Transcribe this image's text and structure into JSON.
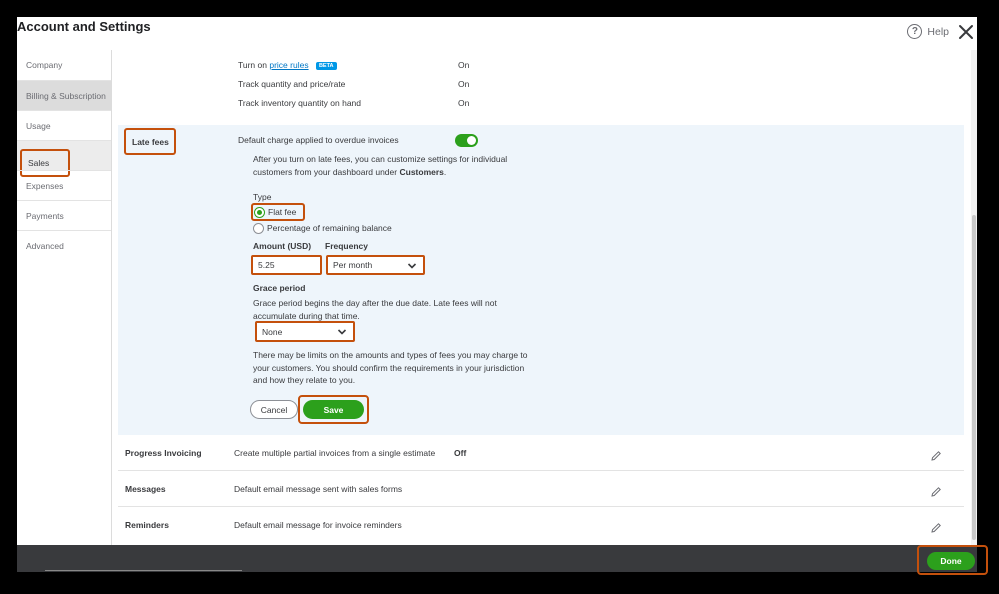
{
  "window": {
    "title": "Account and Settings",
    "help_label": "Help"
  },
  "sidebar": {
    "items": [
      {
        "label": "Company"
      },
      {
        "label": "Billing & Subscription"
      },
      {
        "label": "Usage"
      },
      {
        "label": "Sales"
      },
      {
        "label": "Expenses"
      },
      {
        "label": "Payments"
      },
      {
        "label": "Advanced"
      }
    ]
  },
  "products": {
    "price_rules_prefix": "Turn on",
    "price_rules_link": "price rules",
    "beta_badge": "BETA",
    "price_rules_value": "On",
    "track_qty_label": "Track quantity and price/rate",
    "track_qty_value": "On",
    "track_inventory_label": "Track inventory quantity on hand",
    "track_inventory_value": "On"
  },
  "late_fees": {
    "label": "Late fees",
    "description": "Default charge applied to overdue invoices",
    "toggle_on": true,
    "info_line1": "After you turn on late fees, you can customize settings for individual",
    "info_line2_prefix": "customers from your dashboard under",
    "info_line2_bold": "Customers",
    "info_line2_suffix": ".",
    "type_label": "Type",
    "option_flat_fee": "Flat fee",
    "option_percentage": "Percentage of remaining balance",
    "selected_type": "Flat fee",
    "amount_label": "Amount (USD)",
    "amount_value": "5.25",
    "frequency_label": "Frequency",
    "frequency_value": "Per month",
    "grace_label": "Grace period",
    "grace_line1": "Grace period begins the day after the due date. Late fees will not",
    "grace_line2": "accumulate during that time.",
    "grace_value": "None",
    "limits_line1": "There may be limits on the amounts and types of fees you may charge to",
    "limits_line2": "your customers. You should confirm the requirements in your jurisdiction",
    "limits_line3": "and how they relate to you.",
    "cancel_label": "Cancel",
    "save_label": "Save"
  },
  "rows": [
    {
      "name": "Progress Invoicing",
      "desc": "Create multiple partial invoices from a single estimate",
      "value": "Off"
    },
    {
      "name": "Messages",
      "desc": "Default email message sent with sales forms",
      "value": ""
    },
    {
      "name": "Reminders",
      "desc": "Default email message for invoice reminders",
      "value": ""
    }
  ],
  "footer": {
    "done_label": "Done"
  },
  "colors": {
    "accent_green": "#2ca01c",
    "highlight": "#c4500c",
    "link_blue": "#0077c5"
  }
}
